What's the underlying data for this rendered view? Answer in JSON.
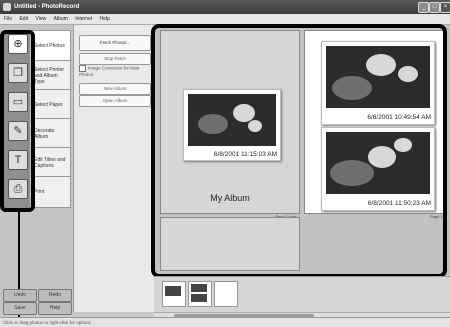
{
  "window": {
    "title": "Untitled - PhotoRecord",
    "min_label": "_",
    "max_label": "□",
    "close_label": "×"
  },
  "menu": [
    "File",
    "Edit",
    "View",
    "Album",
    "Internet",
    "Help"
  ],
  "steps": [
    {
      "label": "Select Photos",
      "icon": "add-photo-icon"
    },
    {
      "label": "Select Printer and Album Type",
      "icon": "album-type-icon"
    },
    {
      "label": "Select Paper",
      "icon": "paper-icon"
    },
    {
      "label": "Decorate Album",
      "icon": "decorate-icon"
    },
    {
      "label": "Edit Titles and Captions",
      "icon": "text-icon"
    },
    {
      "label": "Print",
      "icon": "printer-icon"
    }
  ],
  "options": {
    "fetch_photos": "Fetch Photos...",
    "stop_fetch": "Stop Fetch",
    "image_correction": "Image Correction for New Photos",
    "new_album": "New Album",
    "open_album": "Open Album"
  },
  "album": {
    "title": "My Album",
    "cover_label": "Back Cover",
    "page_label": "Page 1",
    "photos": [
      {
        "date": "6/8/2001 11:15:03 AM"
      },
      {
        "date": "6/8/2001 10:49:54 AM"
      },
      {
        "date": "6/8/2001 11:50:23 AM"
      }
    ]
  },
  "bottom_buttons": {
    "undo": "Undo",
    "redo": "Redo",
    "save": "Save",
    "help": "Help"
  },
  "status": {
    "text": "Click or drag photos or right-click for options"
  }
}
